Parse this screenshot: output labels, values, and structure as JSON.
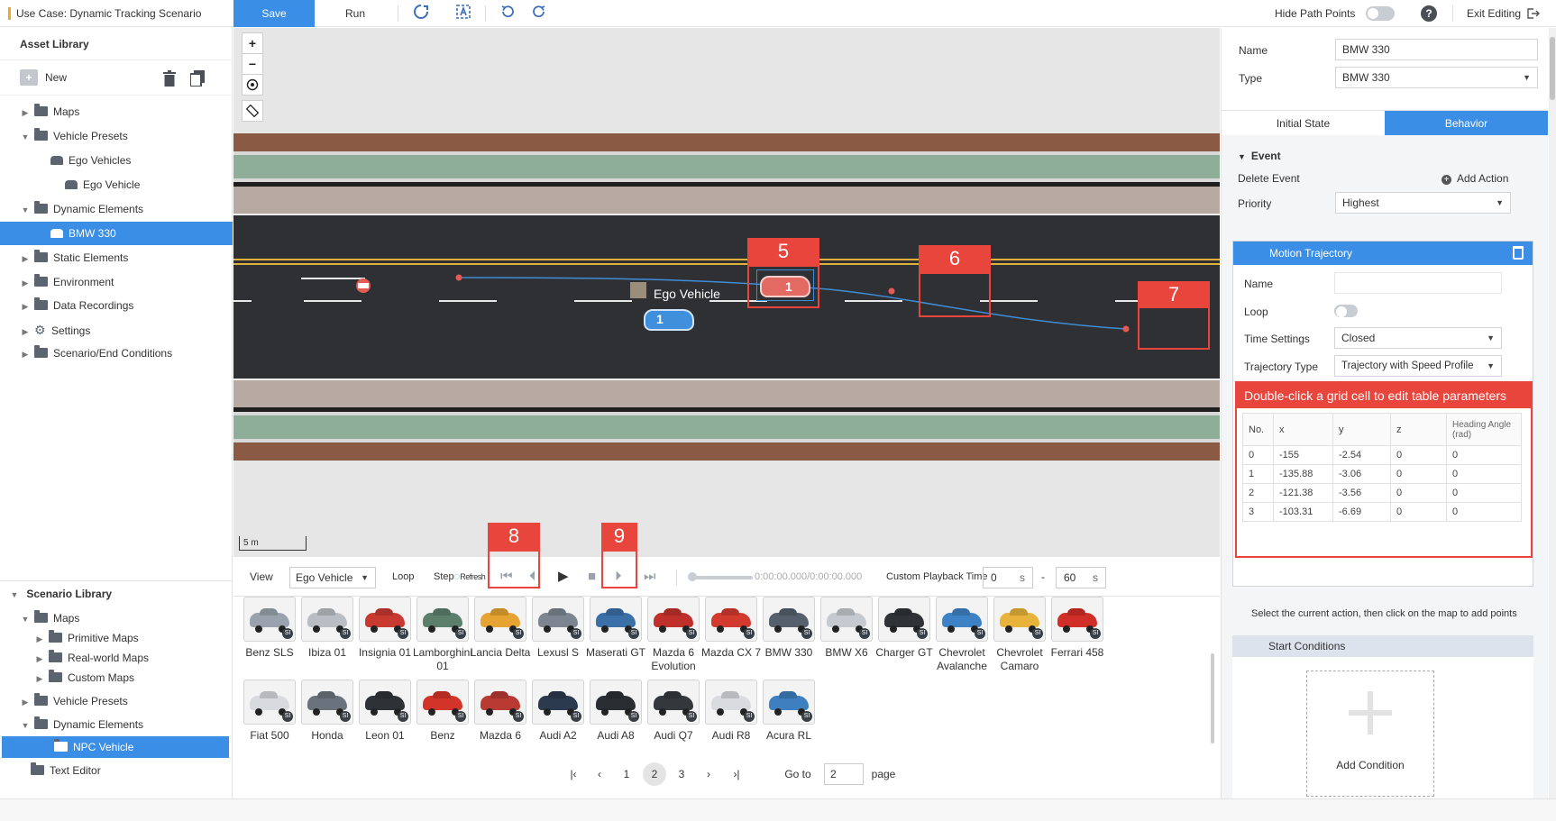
{
  "topbar": {
    "use_case": "Use Case: Dynamic Tracking Scenario",
    "save": "Save",
    "run": "Run",
    "hide_path_points": "Hide Path Points",
    "help": "?",
    "exit_editing": "Exit Editing"
  },
  "asset_library": {
    "title": "Asset Library",
    "new": "New",
    "items": [
      {
        "label": "Maps",
        "caret": "▶"
      },
      {
        "label": "Vehicle Presets",
        "caret": "▼"
      },
      {
        "label": "Ego Vehicles",
        "caret": ""
      },
      {
        "label": "Ego Vehicle",
        "caret": ""
      },
      {
        "label": "Dynamic Elements",
        "caret": "▼"
      },
      {
        "label": "BMW 330",
        "caret": ""
      },
      {
        "label": "Static Elements",
        "caret": "▶"
      },
      {
        "label": "Environment",
        "caret": "▶"
      },
      {
        "label": "Data Recordings",
        "caret": "▶"
      },
      {
        "label": "Settings",
        "caret": "▶"
      },
      {
        "label": "Scenario/End Conditions",
        "caret": "▶"
      }
    ]
  },
  "scenario_library": {
    "title": "Scenario Library",
    "items": [
      {
        "label": "Maps",
        "caret": "▼"
      },
      {
        "label": "Primitive Maps",
        "caret": "▶"
      },
      {
        "label": "Real-world Maps",
        "caret": "▶"
      },
      {
        "label": "Custom Maps",
        "caret": "▶"
      },
      {
        "label": "Vehicle Presets",
        "caret": "▶"
      },
      {
        "label": "Dynamic Elements",
        "caret": "▼"
      },
      {
        "label": "NPC Vehicle",
        "caret": ""
      },
      {
        "label": "Text Editor",
        "caret": ""
      }
    ]
  },
  "map": {
    "zoom_in": "+",
    "zoom_out": "−",
    "ego_label": "Ego Vehicle",
    "npc_number": "1",
    "ego_number": "1",
    "scale": "5 m",
    "callouts": [
      "5",
      "6",
      "7",
      "8",
      "9"
    ]
  },
  "playback": {
    "view": "View",
    "view_value": "Ego Vehicle",
    "loop": "Loop",
    "step": "Step",
    "refresh": "Refresh",
    "time": "0:00:00.000/0:00:00.000",
    "custom_time": "Custom Playback Time",
    "start": "0",
    "end": "60",
    "unit": "s",
    "dash": "-"
  },
  "vehicles": [
    {
      "name": "Benz SLS",
      "color": "#9aa3ad"
    },
    {
      "name": "Ibiza 01",
      "color": "#b9bec5"
    },
    {
      "name": "Insignia 01",
      "color": "#c83a30"
    },
    {
      "name": "Lamborghini 01",
      "color": "#5c7f6b"
    },
    {
      "name": "Lancia Delta",
      "color": "#e6a332"
    },
    {
      "name": "Lexusl S",
      "color": "#7c8590"
    },
    {
      "name": "Maserati GT",
      "color": "#3b6fa8"
    },
    {
      "name": "Mazda 6 Evolution",
      "color": "#c0302a"
    },
    {
      "name": "Mazda CX 7",
      "color": "#d23a2e"
    },
    {
      "name": "BMW 330",
      "color": "#55606c"
    },
    {
      "name": "BMW X6",
      "color": "#c5cad0"
    },
    {
      "name": "Charger GT",
      "color": "#2f3338"
    },
    {
      "name": "Chevrolet Avalanche",
      "color": "#3d82c4"
    },
    {
      "name": "Chevrolet Camaro",
      "color": "#e8b33a"
    },
    {
      "name": "Ferrari 458",
      "color": "#d02e26"
    },
    {
      "name": "Fiat 500",
      "color": "#d8dadd"
    },
    {
      "name": "Honda",
      "color": "#6a737d"
    },
    {
      "name": "Leon 01",
      "color": "#2e3237"
    },
    {
      "name": "Benz",
      "color": "#d3342a"
    },
    {
      "name": "Mazda 6",
      "color": "#b83a32"
    },
    {
      "name": "Audi A2",
      "color": "#2c3a4f"
    },
    {
      "name": "Audi A8",
      "color": "#2a2e33"
    },
    {
      "name": "Audi Q7",
      "color": "#34383d"
    },
    {
      "name": "Audi R8",
      "color": "#d9dbde"
    },
    {
      "name": "Acura RL",
      "color": "#3d7fbf"
    }
  ],
  "badge": "SI",
  "pager": {
    "first": "|‹",
    "prev": "‹",
    "pages": [
      "1",
      "2",
      "3"
    ],
    "next": "›",
    "last": "›|",
    "goto": "Go to",
    "goto_value": "2",
    "page": "page"
  },
  "props": {
    "name_label": "Name",
    "name_value": "BMW 330",
    "type_label": "Type",
    "type_value": "BMW 330",
    "tab_initial": "Initial State",
    "tab_behavior": "Behavior",
    "event": "Event",
    "delete_event": "Delete Event",
    "add_action": "Add Action",
    "priority_label": "Priority",
    "priority_value": "Highest",
    "motion_trajectory": "Motion Trajectory",
    "mt_name": "Name",
    "mt_loop": "Loop",
    "time_settings": "Time Settings",
    "time_settings_value": "Closed",
    "trajectory_type": "Trajectory Type",
    "trajectory_type_value": "Trajectory with Speed Profile",
    "hint": "Double-click a grid cell to edit table parameters",
    "table_headers": [
      "No.",
      "x",
      "y",
      "z",
      "Heading Angle (rad)"
    ],
    "table_rows": [
      [
        "0",
        "-155",
        "-2.54",
        "0",
        "0"
      ],
      [
        "1",
        "-135.88",
        "-3.06",
        "0",
        "0"
      ],
      [
        "2",
        "-121.38",
        "-3.56",
        "0",
        "0"
      ],
      [
        "3",
        "-103.31",
        "-6.69",
        "0",
        "0"
      ]
    ],
    "select_hint": "Select the current action, then click on the map to add points",
    "start_conditions": "Start Conditions",
    "add_condition": "Add Condition"
  }
}
